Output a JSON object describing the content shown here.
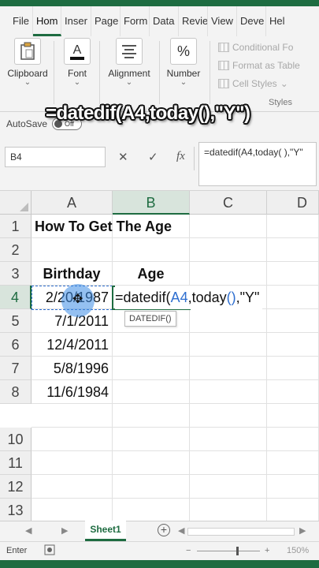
{
  "ribbon_tabs": [
    "File",
    "Hom",
    "Inser",
    "Page",
    "Form",
    "Data",
    "Revie",
    "View",
    "Deve",
    "Hel"
  ],
  "active_tab": "Hom",
  "groups": {
    "clipboard": "Clipboard",
    "font": "Font",
    "alignment": "Alignment",
    "number": "Number",
    "number_icon": "%"
  },
  "styles": {
    "conditional": "Conditional Fo",
    "format_table": "Format as Table",
    "cell_styles": "Cell Styles",
    "title": "Styles"
  },
  "caption": "=datedif(A4,today(),\"Y\")",
  "autosave": {
    "label": "AutoSave",
    "state": "Off"
  },
  "formula_bar": {
    "name_box": "B4",
    "cancel_glyph": "✕",
    "enter_glyph": "✓",
    "fx_glyph": "fx",
    "content": "=datedif(A4,today( ),\"Y\""
  },
  "columns": [
    "A",
    "B",
    "C",
    "D"
  ],
  "rows": [
    "1",
    "2",
    "3",
    "4",
    "5",
    "6",
    "7",
    "8",
    "10",
    "11",
    "12",
    "13"
  ],
  "cells": {
    "title": "How To Get The Age",
    "birthday_header": "Birthday",
    "age_header": "Age",
    "a4": "2/20/1987",
    "a5": "7/1/2011",
    "a6": "12/4/2011",
    "a7": "5/8/1996",
    "a8": "11/6/1984"
  },
  "editing": {
    "prefix": "=datedif(",
    "ref": "A4",
    "mid": ",today",
    "parens": "()",
    "suffix": ",\"Y\"",
    "tooltip": "DATEDIF()"
  },
  "sheet": {
    "name": "Sheet1",
    "add": "+"
  },
  "status": {
    "mode": "Enter",
    "zoom": "150%"
  }
}
